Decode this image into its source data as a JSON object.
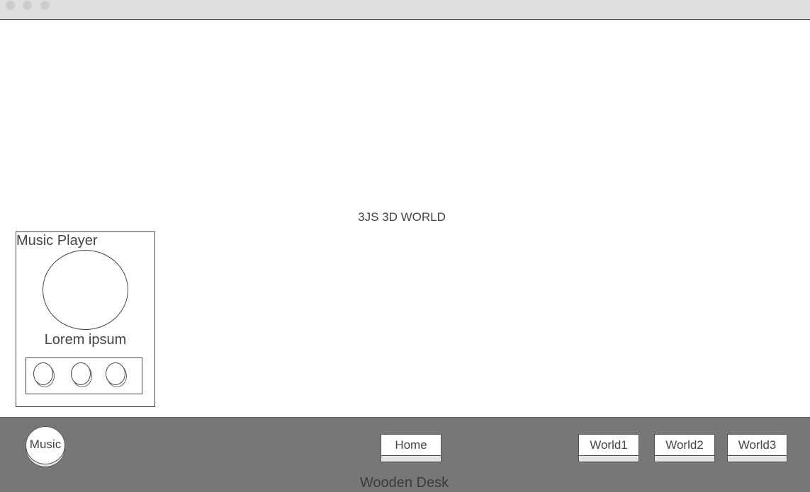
{
  "window": {
    "controls": [
      "close-dot",
      "minimize-dot",
      "maximize-dot"
    ]
  },
  "scene": {
    "label": "3JS 3D WORLD"
  },
  "music_player": {
    "title": "Music Player",
    "track_title": "Lorem ipsum",
    "controls": [
      "previous-button",
      "play-button",
      "next-button"
    ]
  },
  "bottom_bar": {
    "music_button": "Music",
    "home_button": "Home",
    "world_buttons": [
      "World1",
      "World2",
      "World3"
    ],
    "desk_label": "Wooden Desk"
  },
  "colors": {
    "titlebar": "#dedede",
    "bottom_bar": "#777777",
    "border": "#444444"
  }
}
